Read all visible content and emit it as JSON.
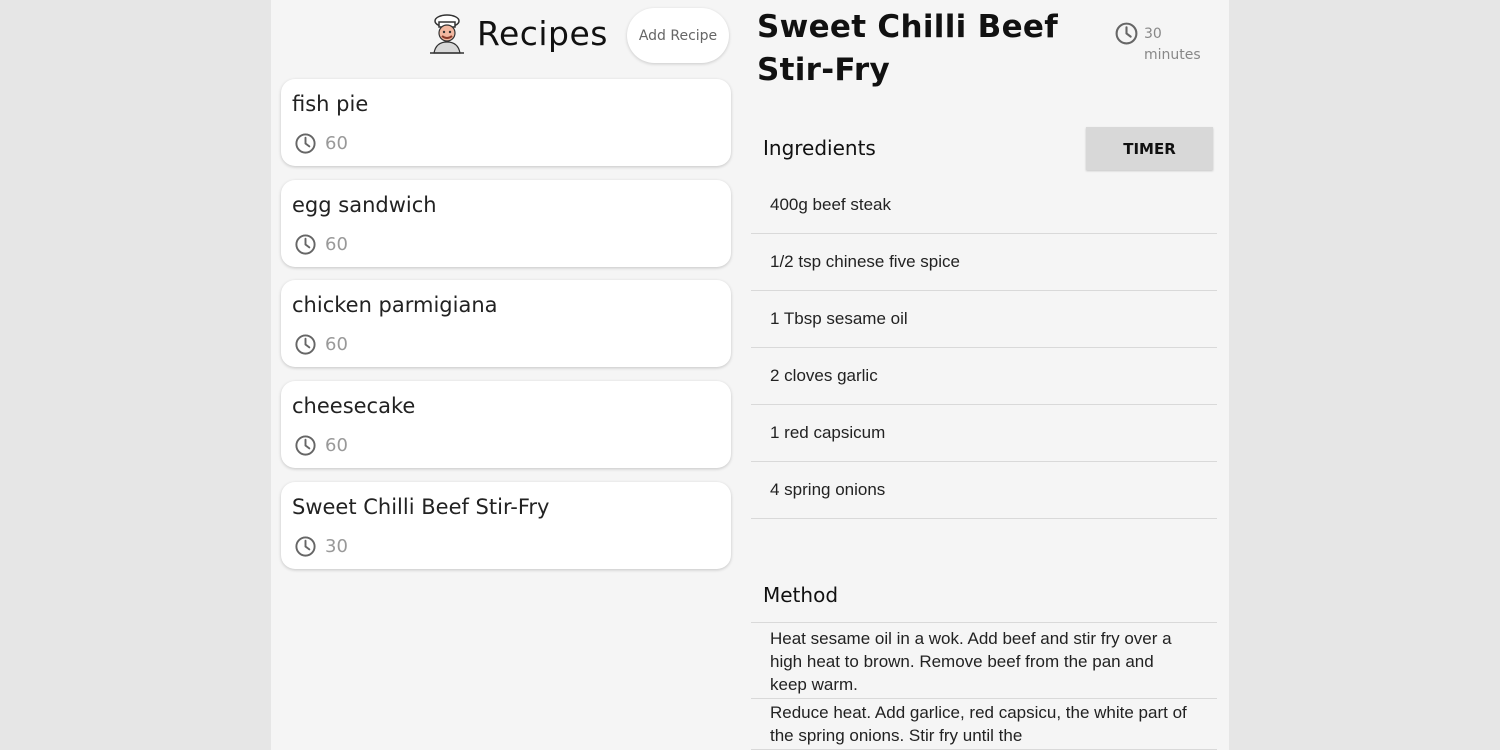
{
  "header": {
    "app_title": "Recipes",
    "add_button_label": "Add Recipe"
  },
  "recipes": [
    {
      "name": "fish pie",
      "time": "60"
    },
    {
      "name": "egg sandwich",
      "time": "60"
    },
    {
      "name": "chicken parmigiana",
      "time": "60"
    },
    {
      "name": "cheesecake",
      "time": "60"
    },
    {
      "name": "Sweet Chilli Beef Stir-Fry",
      "time": "30"
    }
  ],
  "detail": {
    "title": "Sweet Chilli Beef Stir-Fry",
    "time_value": "30",
    "time_unit": "minutes",
    "ingredients_label": "Ingredients",
    "timer_label": "TIMER",
    "ingredients": [
      "400g beef steak",
      "1/2 tsp chinese five spice",
      "1 Tbsp sesame oil",
      "2 cloves garlic",
      "1 red capsicum",
      "4 spring onions"
    ],
    "method_label": "Method",
    "method_steps": [
      "Heat sesame oil in a wok. Add beef and stir fry over a high heat to brown. Remove beef from the pan and keep warm.",
      "Reduce heat. Add garlice, red capsicu, the white part of the spring onions. Stir fry until the"
    ]
  },
  "icons": {
    "logo": "chef-logo-icon",
    "clock": "clock-icon"
  },
  "colors": {
    "page_background": "#e6e6e6",
    "app_background": "#f5f5f5",
    "card_background": "#ffffff",
    "timer_button": "#d8d8d8"
  }
}
